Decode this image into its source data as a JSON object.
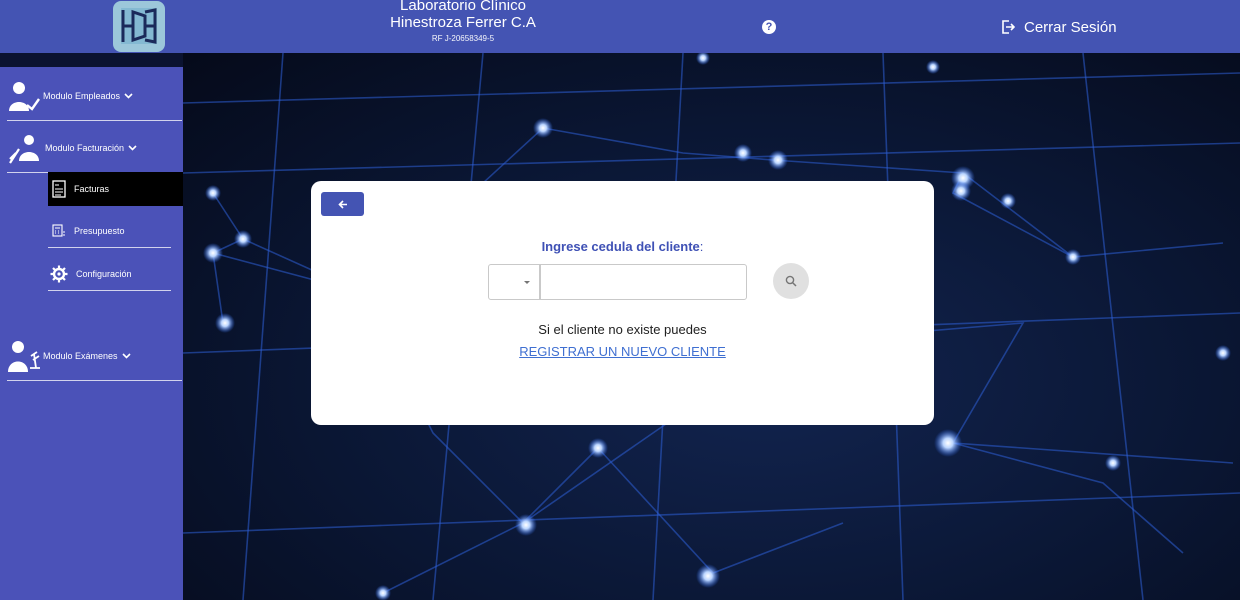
{
  "header": {
    "brand_line1": "Laboratorio Clínico",
    "brand_line2": "Hinestroza Ferrer C.A",
    "rif": "RF J-20658349-5",
    "help_icon": "question-circle-icon",
    "logout_label": "Cerrar Sesión",
    "logout_icon": "logout-icon"
  },
  "sidebar": {
    "modules": [
      {
        "label": "Modulo Empleados",
        "icon": "employee-icon"
      },
      {
        "label": "Modulo Facturación",
        "icon": "billing-icon"
      },
      {
        "label": "Modulo Exámenes",
        "icon": "lab-exams-icon"
      }
    ],
    "billing_items": [
      {
        "label": "Facturas",
        "icon": "invoice-icon",
        "active": true
      },
      {
        "label": "Presupuesto",
        "icon": "calculator-icon",
        "active": false
      },
      {
        "label": "Configuración",
        "icon": "gear-icon",
        "active": false
      }
    ]
  },
  "card": {
    "back_icon": "arrow-left-icon",
    "prompt": "Ingrese cedula del cliente",
    "prompt_colon": ":",
    "doc_type_value": "",
    "id_value": "",
    "id_placeholder": "",
    "search_icon": "search-icon",
    "info_text": "Si el cliente no existe puedes",
    "register_link": "REGISTRAR UN NUEVO CLIENTE"
  },
  "colors": {
    "header": "#4454b3",
    "sidebar": "#4b52b8",
    "active_item": "#000000",
    "prompt": "#3f51b5",
    "link": "#3f6fd1"
  }
}
